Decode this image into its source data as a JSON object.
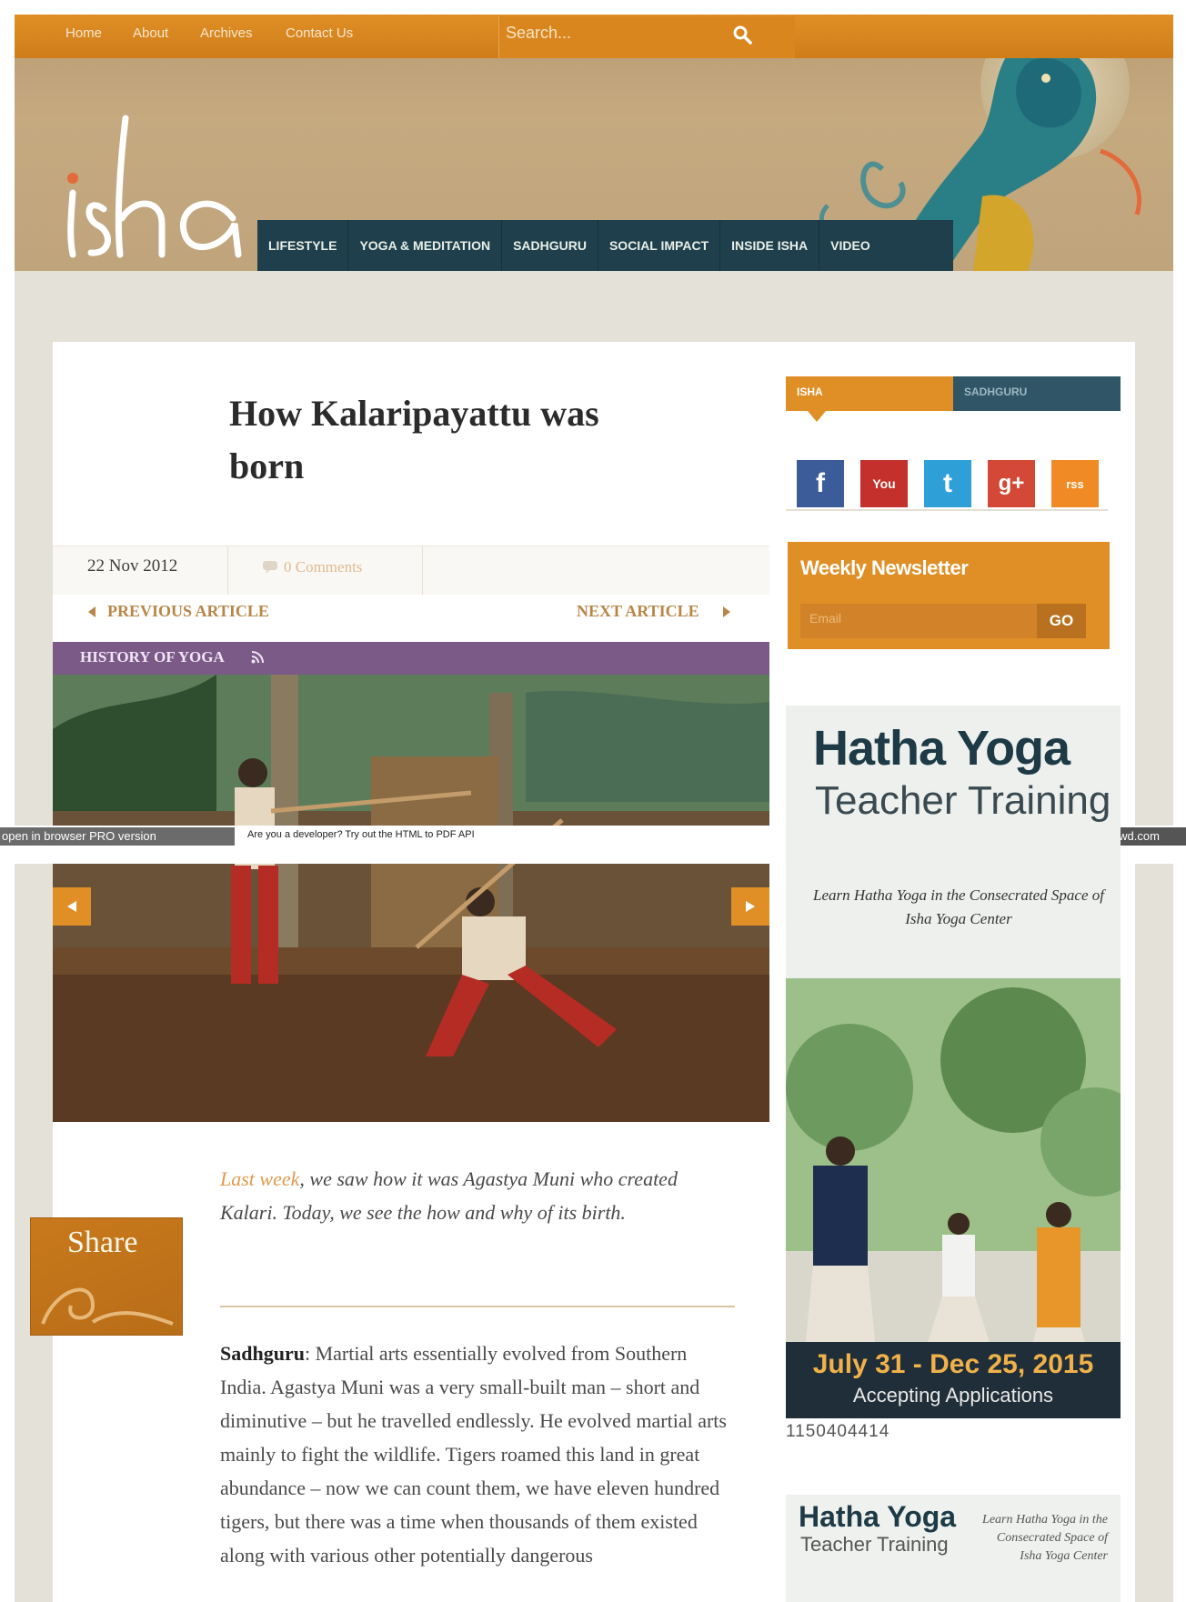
{
  "topnav": {
    "links": [
      "Home",
      "About",
      "Archives",
      "Contact Us"
    ],
    "search_placeholder": "Search..."
  },
  "brand": {
    "logo_text": "isha"
  },
  "mainnav": [
    "LIFESTYLE",
    "YOGA & MEDITATION",
    "SADHGURU",
    "SOCIAL IMPACT",
    "INSIDE ISHA",
    "VIDEO"
  ],
  "article": {
    "title": "How Kalaripayattu was born",
    "date": "22 Nov 2012",
    "comments": "0 Comments",
    "prev_label": "PREVIOUS ARTICLE",
    "next_label": "NEXT ARTICLE",
    "category": "HISTORY OF YOGA",
    "intro_link": "Last week",
    "intro_rest": ", we saw how it was Agastya Muni who created Kalari. Today, we see the how and why of its birth.",
    "body_speaker": "Sadhguru",
    "body_text": ": Martial arts essentially evolved from Southern India. Agastya Muni was a very small-built man – short and diminutive – but he travelled endlessly. He evolved martial arts mainly to fight the wildlife. Tigers roamed this land in great abundance – now we can count them, we have eleven hundred tigers, but there was a time when thousands of them existed along with various other potentially dangerous"
  },
  "share": {
    "label": "Share"
  },
  "pdfcrowd": {
    "left": "open in browser  PRO version",
    "message": "Are you a developer? Try out the HTML to PDF API",
    "right": "pdfcrowd.com"
  },
  "sidebar": {
    "tabs": [
      "ISHA",
      "SADHGURU"
    ],
    "social": [
      {
        "icon": "facebook-icon",
        "glyph": "f",
        "color": "#3b5b99"
      },
      {
        "icon": "youtube-icon",
        "glyph": "You",
        "color": "#c4302b"
      },
      {
        "icon": "twitter-icon",
        "glyph": "t",
        "color": "#2f9fd8"
      },
      {
        "icon": "googleplus-icon",
        "glyph": "g+",
        "color": "#d34836"
      },
      {
        "icon": "rss-icon",
        "glyph": "rss",
        "color": "#f08a24"
      }
    ],
    "newsletter": {
      "title": "Weekly Newsletter",
      "placeholder": "Email",
      "button": "GO"
    },
    "ad1": {
      "title": "Hatha Yoga",
      "subtitle": "Teacher Training",
      "tagline": "Learn Hatha Yoga in the Consecrated Space of Isha Yoga Center",
      "dates": "July 31 - Dec 25, 2015",
      "status": "Accepting Applications",
      "caption": "1150404414"
    },
    "ad2": {
      "title": "Hatha Yoga",
      "subtitle": "Teacher Training",
      "tagline": "Learn Hatha Yoga in the Consecrated Space of Isha Yoga Center"
    }
  },
  "colors": {
    "orange": "#e08f26",
    "navy": "#1f3f4c",
    "purple": "#7b5a88"
  }
}
